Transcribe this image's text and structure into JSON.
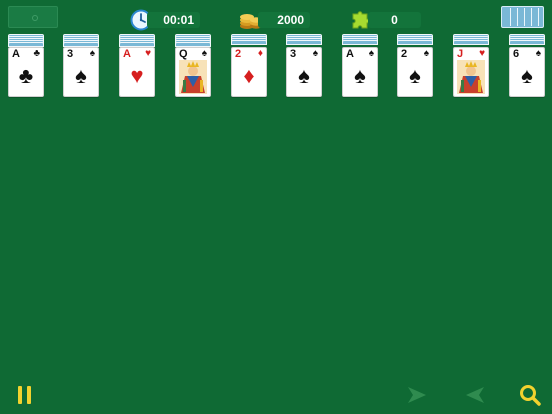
{
  "hud": {
    "timer": "00:01",
    "coins": "2000",
    "moves": "0"
  },
  "icons": {
    "timer": "clock-icon",
    "coins": "coin-stack-icon",
    "puzzle": "puzzle-icon",
    "pause": "pause-icon",
    "redo": "redo-arrow-icon",
    "undo": "undo-arrow-icon",
    "hint": "search-icon"
  },
  "colors": {
    "table_background": "#0f6a34",
    "card_back": "#7ab8d6",
    "red_suit": "#d61f1f",
    "black_suit": "#111111",
    "accent_yellow": "#f2d22e"
  },
  "tableau": [
    {
      "rank": "A",
      "suit_symbol": "♣",
      "suit_name": "clubs",
      "color": "black",
      "face": false,
      "hidden_count": 5
    },
    {
      "rank": "3",
      "suit_symbol": "♠",
      "suit_name": "spades",
      "color": "black",
      "face": false,
      "hidden_count": 5
    },
    {
      "rank": "A",
      "suit_symbol": "♥",
      "suit_name": "hearts",
      "color": "red",
      "face": false,
      "hidden_count": 5
    },
    {
      "rank": "Q",
      "suit_symbol": "♠",
      "suit_name": "spades",
      "color": "black",
      "face": true,
      "hidden_count": 5
    },
    {
      "rank": "2",
      "suit_symbol": "♦",
      "suit_name": "diamonds",
      "color": "red",
      "face": false,
      "hidden_count": 4
    },
    {
      "rank": "3",
      "suit_symbol": "♠",
      "suit_name": "spades",
      "color": "black",
      "face": false,
      "hidden_count": 4
    },
    {
      "rank": "A",
      "suit_symbol": "♠",
      "suit_name": "spades",
      "color": "black",
      "face": false,
      "hidden_count": 4
    },
    {
      "rank": "2",
      "suit_symbol": "♠",
      "suit_name": "spades",
      "color": "black",
      "face": false,
      "hidden_count": 4
    },
    {
      "rank": "J",
      "suit_symbol": "♥",
      "suit_name": "hearts",
      "color": "red",
      "face": true,
      "hidden_count": 4
    },
    {
      "rank": "6",
      "suit_symbol": "♠",
      "suit_name": "spades",
      "color": "black",
      "face": false,
      "hidden_count": 4
    }
  ]
}
